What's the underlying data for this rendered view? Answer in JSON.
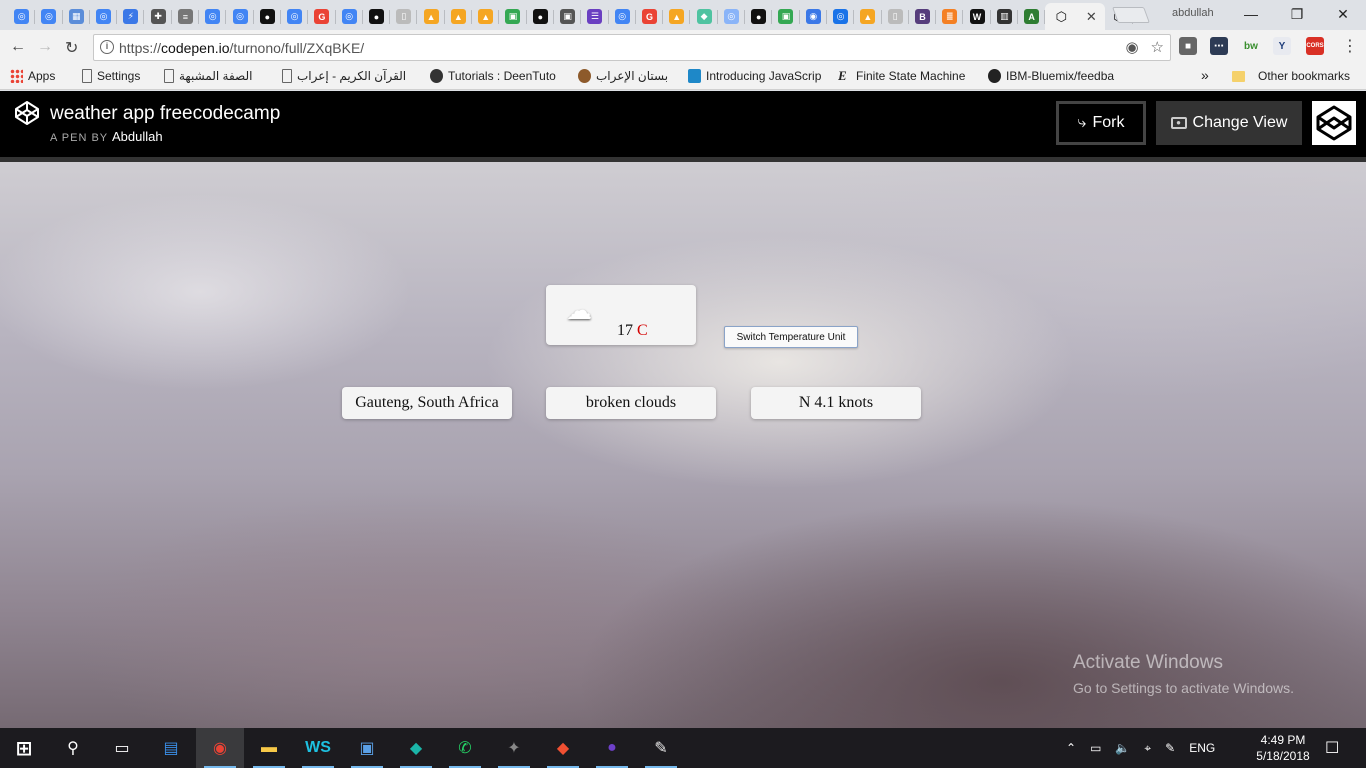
{
  "browser": {
    "profile_name": "abdullah",
    "url_prefix": "https://",
    "url_host": "codepen.io",
    "url_path": "/turnono/full/ZXqBKE/",
    "tab_favicons": [
      {
        "icon": "chrome-icon",
        "color": "#4285f4",
        "glyph": "◎"
      },
      {
        "icon": "chrome-icon",
        "color": "#4285f4",
        "glyph": "◎"
      },
      {
        "icon": "grid-icon",
        "color": "#5b8dd9",
        "glyph": "▦"
      },
      {
        "icon": "chrome-icon",
        "color": "#4285f4",
        "glyph": "◎"
      },
      {
        "icon": "bolt-icon",
        "color": "#3b78e7",
        "glyph": "⚡"
      },
      {
        "icon": "puzzle-icon",
        "color": "#555555",
        "glyph": "✚"
      },
      {
        "icon": "doc-icon",
        "color": "#777777",
        "glyph": "≡"
      },
      {
        "icon": "chrome-icon",
        "color": "#4285f4",
        "glyph": "◎"
      },
      {
        "icon": "chrome-icon",
        "color": "#4285f4",
        "glyph": "◎"
      },
      {
        "icon": "github-icon",
        "color": "#111111",
        "glyph": "●"
      },
      {
        "icon": "chrome-icon",
        "color": "#4285f4",
        "glyph": "◎"
      },
      {
        "icon": "google-icon",
        "color": "#ea4335",
        "glyph": "G"
      },
      {
        "icon": "chrome-icon",
        "color": "#4285f4",
        "glyph": "◎"
      },
      {
        "icon": "github-icon",
        "color": "#111111",
        "glyph": "●"
      },
      {
        "icon": "page-icon",
        "color": "#bbbbbb",
        "glyph": "▯"
      },
      {
        "icon": "firebase-icon",
        "color": "#f5a623",
        "glyph": "▲"
      },
      {
        "icon": "firebase-icon",
        "color": "#f5a623",
        "glyph": "▲"
      },
      {
        "icon": "firebase-icon",
        "color": "#f5a623",
        "glyph": "▲"
      },
      {
        "icon": "image-icon",
        "color": "#34a853",
        "glyph": "▣"
      },
      {
        "icon": "github-icon",
        "color": "#111111",
        "glyph": "●"
      },
      {
        "icon": "contact-icon",
        "color": "#555555",
        "glyph": "▣"
      },
      {
        "icon": "list-icon",
        "color": "#6a3fc1",
        "glyph": "☰"
      },
      {
        "icon": "chrome-icon",
        "color": "#4285f4",
        "glyph": "◎"
      },
      {
        "icon": "google-icon",
        "color": "#ea4335",
        "glyph": "G"
      },
      {
        "icon": "firebase-icon",
        "color": "#f5a623",
        "glyph": "▲"
      },
      {
        "icon": "diamond-icon",
        "color": "#4fc3a1",
        "glyph": "◆"
      },
      {
        "icon": "chrome-icon",
        "color": "#8ab4f8",
        "glyph": "◎"
      },
      {
        "icon": "github-icon",
        "color": "#111111",
        "glyph": "●"
      },
      {
        "icon": "image-icon",
        "color": "#34a853",
        "glyph": "▣"
      },
      {
        "icon": "circle-icon",
        "color": "#3b78e7",
        "glyph": "◉"
      },
      {
        "icon": "circle-icon",
        "color": "#1a73e8",
        "glyph": "◎"
      },
      {
        "icon": "firebase-icon",
        "color": "#f5a623",
        "glyph": "▲"
      },
      {
        "icon": "page-icon",
        "color": "#bbbbbb",
        "glyph": "▯"
      },
      {
        "icon": "bootstrap-icon",
        "color": "#563d7c",
        "glyph": "B"
      },
      {
        "icon": "stackoverflow-icon",
        "color": "#f48024",
        "glyph": "≣"
      },
      {
        "icon": "webstorm-icon",
        "color": "#111111",
        "glyph": "W"
      },
      {
        "icon": "chart-icon",
        "color": "#333333",
        "glyph": "▥"
      },
      {
        "icon": "android-icon",
        "color": "#2e7d32",
        "glyph": "A"
      }
    ],
    "active_tab_icon": "codepen-icon"
  },
  "bookmarks": [
    {
      "label": "Apps",
      "icon": "apps-grid-icon"
    },
    {
      "label": "Settings",
      "icon": "page-icon"
    },
    {
      "label": "الصفة المشبهة",
      "icon": "page-icon"
    },
    {
      "label": "القرآن الكريم - إعراب",
      "icon": "page-icon"
    },
    {
      "label": "Tutorials : DeenTuto",
      "icon": "deentutor-icon"
    },
    {
      "label": "بستان الإعراب",
      "icon": "garden-icon"
    },
    {
      "label": "Introducing JavaScrip",
      "icon": "js-icon"
    },
    {
      "label": "Finite State Machine",
      "icon": "e-icon"
    },
    {
      "label": "IBM-Bluemix/feedba",
      "icon": "github-icon"
    }
  ],
  "bookmarks_more": "»",
  "other_bookmarks": "Other bookmarks",
  "codepen": {
    "title": "weather app freecodecamp",
    "by_prefix": "A PEN BY",
    "author": "Abdullah",
    "fork_label": "Fork",
    "change_view_label": "Change View"
  },
  "weather": {
    "temperature": "17",
    "unit": "C",
    "switch_label": "Switch Temperature Unit",
    "location": "Gauteng, South Africa",
    "description": "broken clouds",
    "wind": "N 4.1 knots",
    "icon": "broken-clouds-icon"
  },
  "watermark": {
    "line1": "Activate Windows",
    "line2": "Go to Settings to activate Windows."
  },
  "taskbar": {
    "apps": [
      {
        "name": "start-icon",
        "color": "#ffffff"
      },
      {
        "name": "search-icon",
        "color": "#ffffff"
      },
      {
        "name": "task-view-icon",
        "color": "#ffffff"
      },
      {
        "name": "file-manager-icon",
        "color": "#3a8ee6"
      },
      {
        "name": "chrome-icon",
        "color": "#ea4335"
      },
      {
        "name": "folder-icon",
        "color": "#f7c948"
      },
      {
        "name": "webstorm-icon",
        "color": "#1ec0e0"
      },
      {
        "name": "remote-desktop-icon",
        "color": "#5aa0e6"
      },
      {
        "name": "gitkraken-icon",
        "color": "#1bb5a8"
      },
      {
        "name": "whatsapp-icon",
        "color": "#25d366"
      },
      {
        "name": "creature-icon",
        "color": "#888888"
      },
      {
        "name": "git-icon",
        "color": "#f05032"
      },
      {
        "name": "github-desktop-icon",
        "color": "#6e40c9"
      },
      {
        "name": "paint-icon",
        "color": "#e8e8e8"
      }
    ],
    "language": "ENG",
    "time": "4:49 PM",
    "date": "5/18/2018"
  }
}
